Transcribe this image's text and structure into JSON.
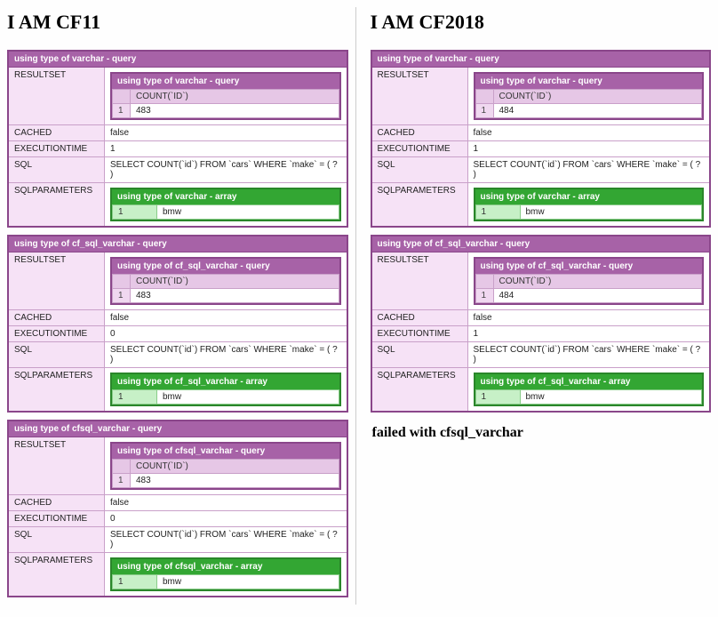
{
  "left": {
    "heading": "I AM CF11",
    "dumps": [
      {
        "title": "using type of varchar - query",
        "resultSet": {
          "title": "using type of varchar - query",
          "colHeader": "COUNT(`ID`)",
          "rowIndex": "1",
          "value": "483"
        },
        "cached": "false",
        "executionTime": "1",
        "sql": "SELECT COUNT(`id`) FROM `cars` WHERE `make` = ( ? )",
        "sqlParams": {
          "title": "using type of varchar - array",
          "index": "1",
          "value": "bmw"
        }
      },
      {
        "title": "using type of cf_sql_varchar - query",
        "resultSet": {
          "title": "using type of cf_sql_varchar - query",
          "colHeader": "COUNT(`ID`)",
          "rowIndex": "1",
          "value": "483"
        },
        "cached": "false",
        "executionTime": "0",
        "sql": "SELECT COUNT(`id`) FROM `cars` WHERE `make` = ( ? )",
        "sqlParams": {
          "title": "using type of cf_sql_varchar - array",
          "index": "1",
          "value": "bmw"
        }
      },
      {
        "title": "using type of cfsql_varchar - query",
        "resultSet": {
          "title": "using type of cfsql_varchar - query",
          "colHeader": "COUNT(`ID`)",
          "rowIndex": "1",
          "value": "483"
        },
        "cached": "false",
        "executionTime": "0",
        "sql": "SELECT COUNT(`id`) FROM `cars` WHERE `make` = ( ? )",
        "sqlParams": {
          "title": "using type of cfsql_varchar - array",
          "index": "1",
          "value": "bmw"
        }
      }
    ]
  },
  "right": {
    "heading": "I AM CF2018",
    "dumps": [
      {
        "title": "using type of varchar - query",
        "resultSet": {
          "title": "using type of varchar - query",
          "colHeader": "COUNT(`ID`)",
          "rowIndex": "1",
          "value": "484"
        },
        "cached": "false",
        "executionTime": "1",
        "sql": "SELECT COUNT(`id`) FROM `cars` WHERE `make` = ( ? )",
        "sqlParams": {
          "title": "using type of varchar - array",
          "index": "1",
          "value": "bmw"
        }
      },
      {
        "title": "using type of cf_sql_varchar - query",
        "resultSet": {
          "title": "using type of cf_sql_varchar - query",
          "colHeader": "COUNT(`ID`)",
          "rowIndex": "1",
          "value": "484"
        },
        "cached": "false",
        "executionTime": "1",
        "sql": "SELECT COUNT(`id`) FROM `cars` WHERE `make` = ( ? )",
        "sqlParams": {
          "title": "using type of cf_sql_varchar - array",
          "index": "1",
          "value": "bmw"
        }
      }
    ],
    "failMessage": "failed with cfsql_varchar"
  },
  "labels": {
    "resultSet": "RESULTSET",
    "cached": "CACHED",
    "executionTime": "EXECUTIONTIME",
    "sql": "SQL",
    "sqlParams": "SQLPARAMETERS"
  }
}
